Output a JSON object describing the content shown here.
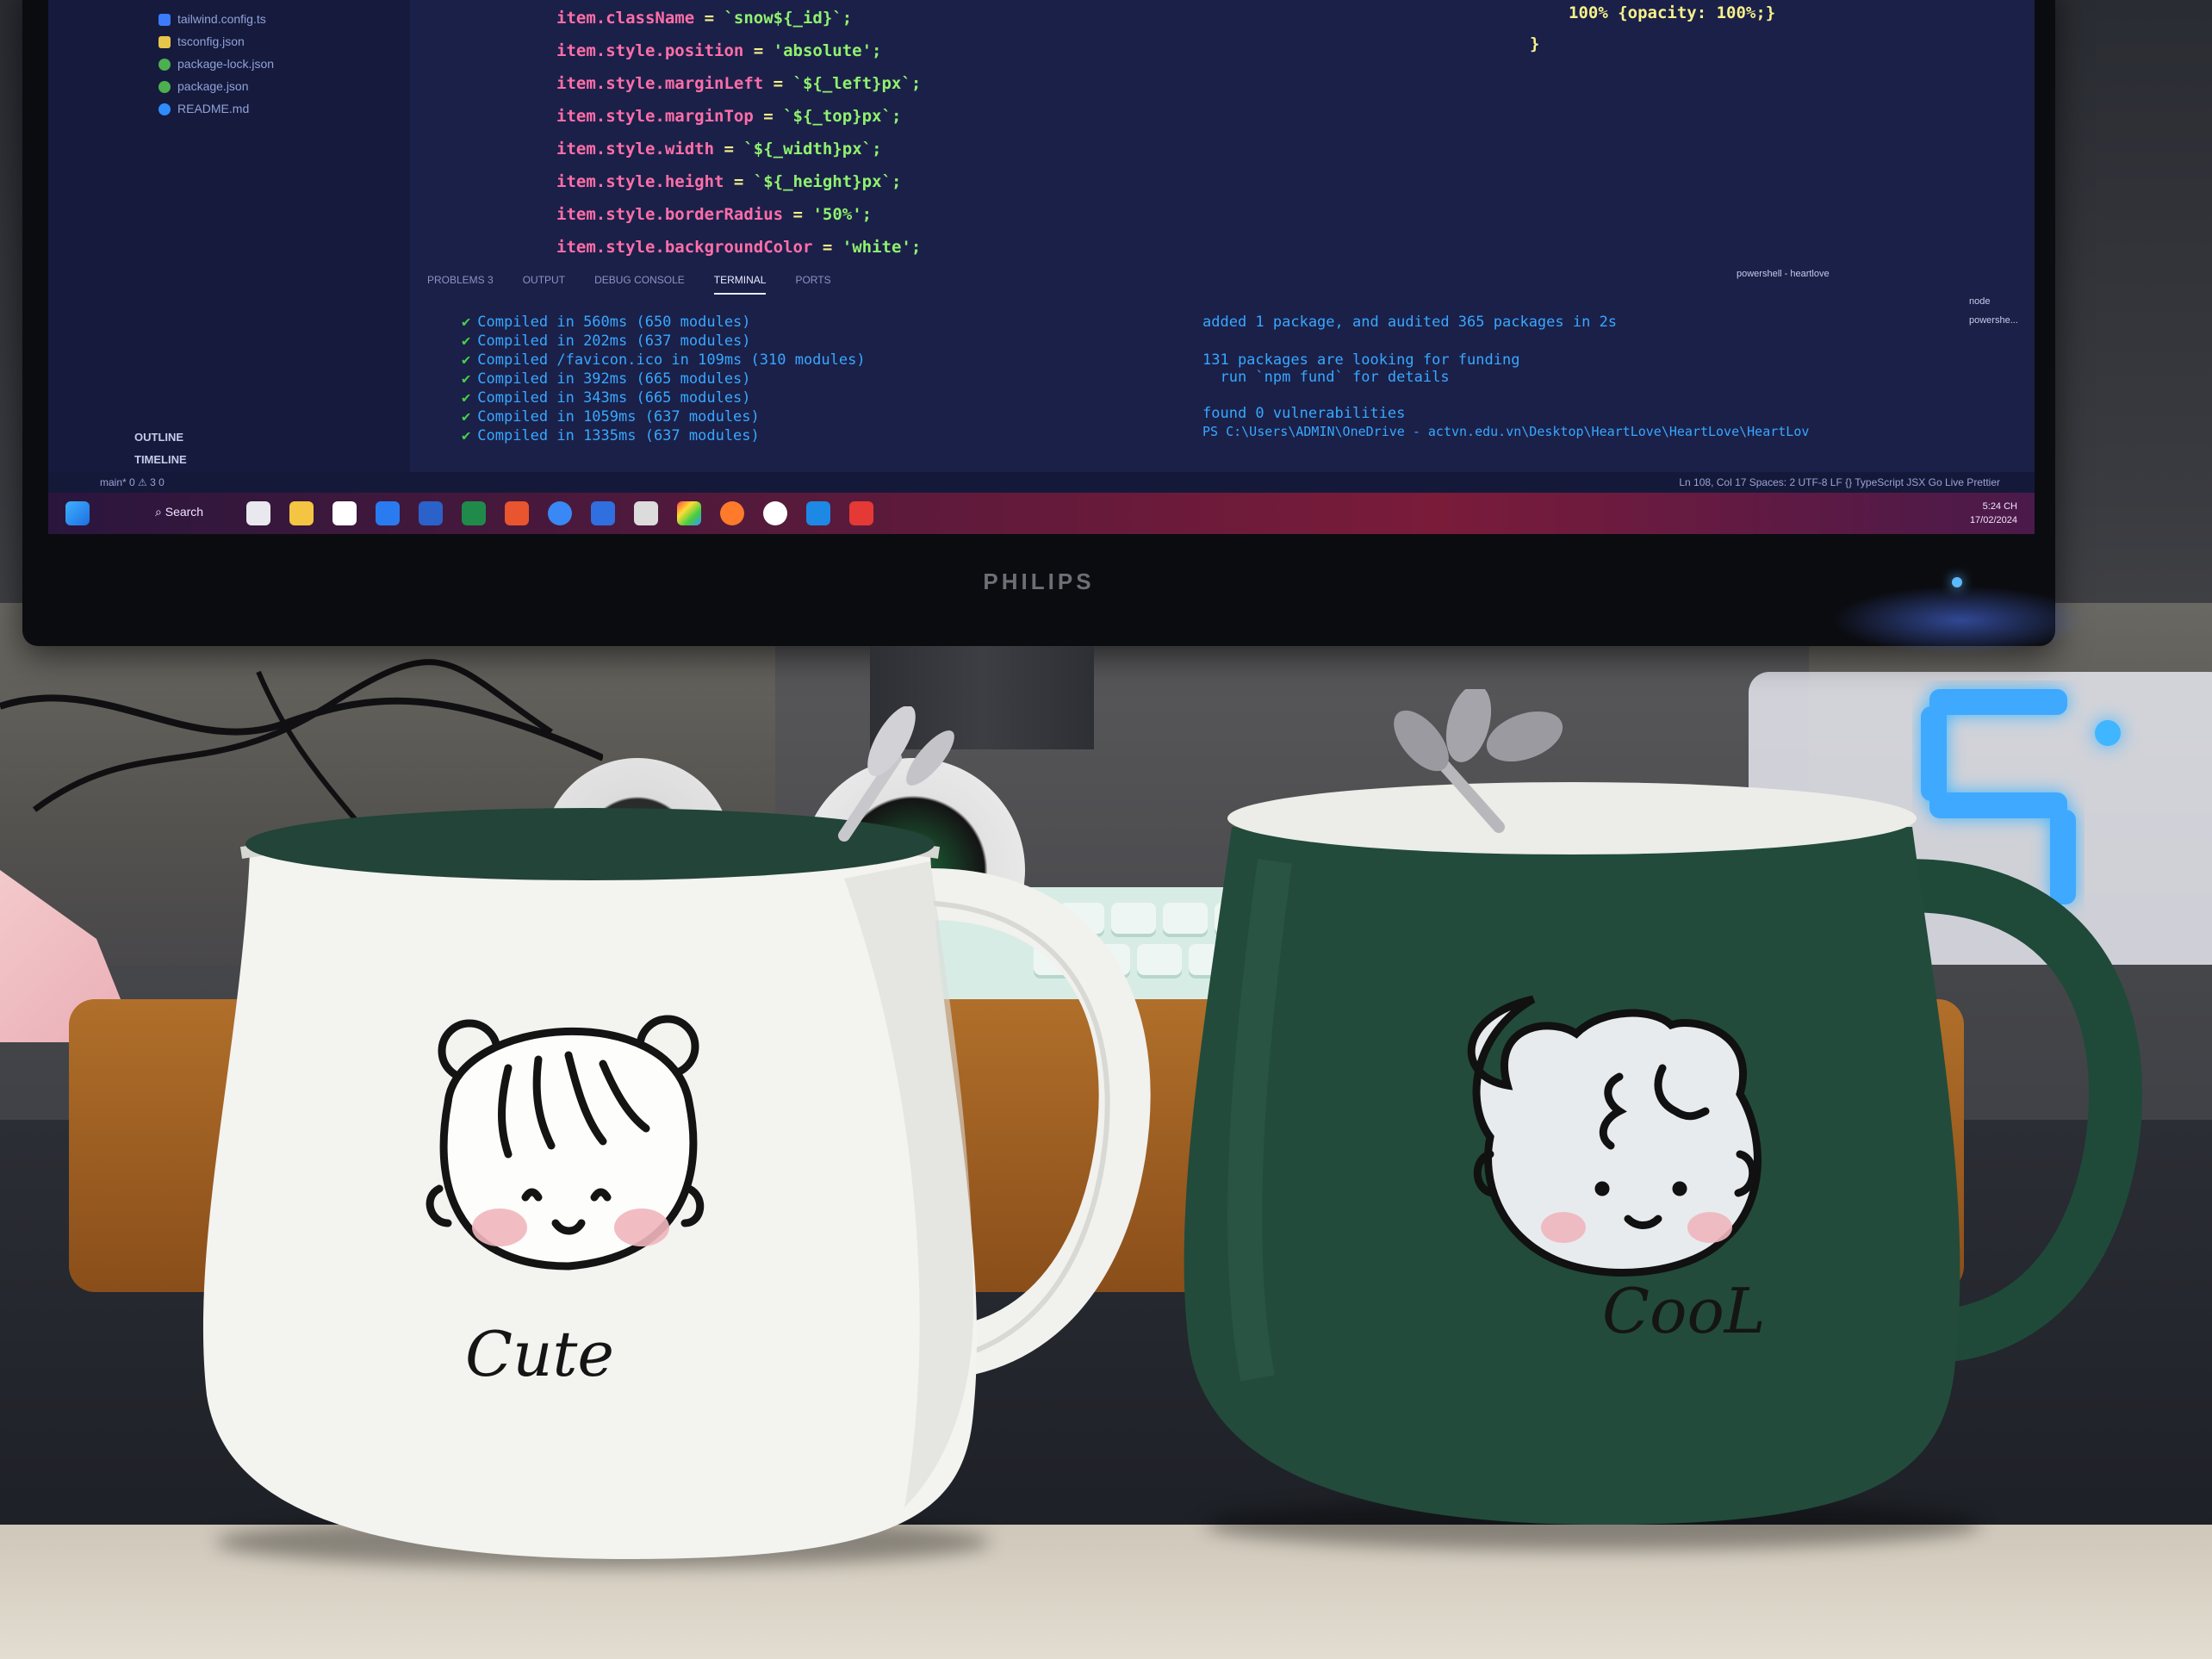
{
  "scene": {
    "description_tag": "photo",
    "monitor_brand": "PHILIPS",
    "accent_colors": {
      "code_bg": "#1b2049",
      "clock_blue": "#3fb6ff",
      "green_mug": "#1f4a3a",
      "white_mug": "#f3f3f1"
    }
  },
  "editor": {
    "explorer_files": [
      "tailwind.config.ts",
      "tsconfig.json",
      "package-lock.json",
      "package.json",
      "README.md"
    ],
    "explorer_sections": [
      "OUTLINE",
      "TIMELINE"
    ],
    "code_lines": [
      {
        "obj": "item.className",
        "op": " = ",
        "val": "`snow${_id}`;"
      },
      {
        "obj": "item.style.position",
        "op": " = ",
        "val": "'absolute';"
      },
      {
        "obj": "item.style.marginLeft",
        "op": " = ",
        "val": "`${_left}px`;"
      },
      {
        "obj": "item.style.marginTop",
        "op": " = ",
        "val": "`${_top}px`;"
      },
      {
        "obj": "item.style.width",
        "op": " = ",
        "val": "`${_width}px`;"
      },
      {
        "obj": "item.style.height",
        "op": " = ",
        "val": "`${_height}px`;"
      },
      {
        "obj": "item.style.borderRadius",
        "op": " = ",
        "val": "'50%';"
      },
      {
        "obj": "item.style.backgroundColor",
        "op": " = ",
        "val": "'white';"
      }
    ],
    "css_line": "100% {opacity: 100%;}",
    "css_brace": "}",
    "panel_tabs": [
      "PROBLEMS",
      "3",
      "OUTPUT",
      "DEBUG CONSOLE",
      "TERMINAL",
      "PORTS"
    ],
    "terminal_left": [
      "Compiled in 560ms (650 modules)",
      "Compiled in 202ms (637 modules)",
      "Compiled /favicon.ico in 109ms (310 modules)",
      "Compiled in 392ms (665 modules)",
      "Compiled in 343ms (665 modules)",
      "Compiled in 1059ms (637 modules)",
      "Compiled in 1335ms (637 modules)"
    ],
    "terminal_right": [
      "added 1 package, and audited 365 packages in 2s",
      "",
      "131 packages are looking for funding",
      "  run `npm fund` for details",
      "",
      "found 0 vulnerabilities",
      "PS C:\\Users\\ADMIN\\OneDrive - actvn.edu.vn\\Desktop\\HeartLove\\HeartLove\\HeartLov"
    ],
    "terminal_tabs": [
      "powershell - heartlove",
      "node",
      "powershe..."
    ],
    "status_right": "Ln 108, Col 17   Spaces: 2   UTF-8   LF   {} TypeScript JSX   Go Live   Prettier",
    "status_left": "main*   0 ⚠ 3   0",
    "taskbar_search": "Search",
    "taskbar_time": "5:24 CH",
    "taskbar_date": "17/02/2024"
  },
  "mugs": [
    {
      "label": "Cute",
      "color": "white"
    },
    {
      "label": "CooL",
      "color": "green"
    }
  ]
}
